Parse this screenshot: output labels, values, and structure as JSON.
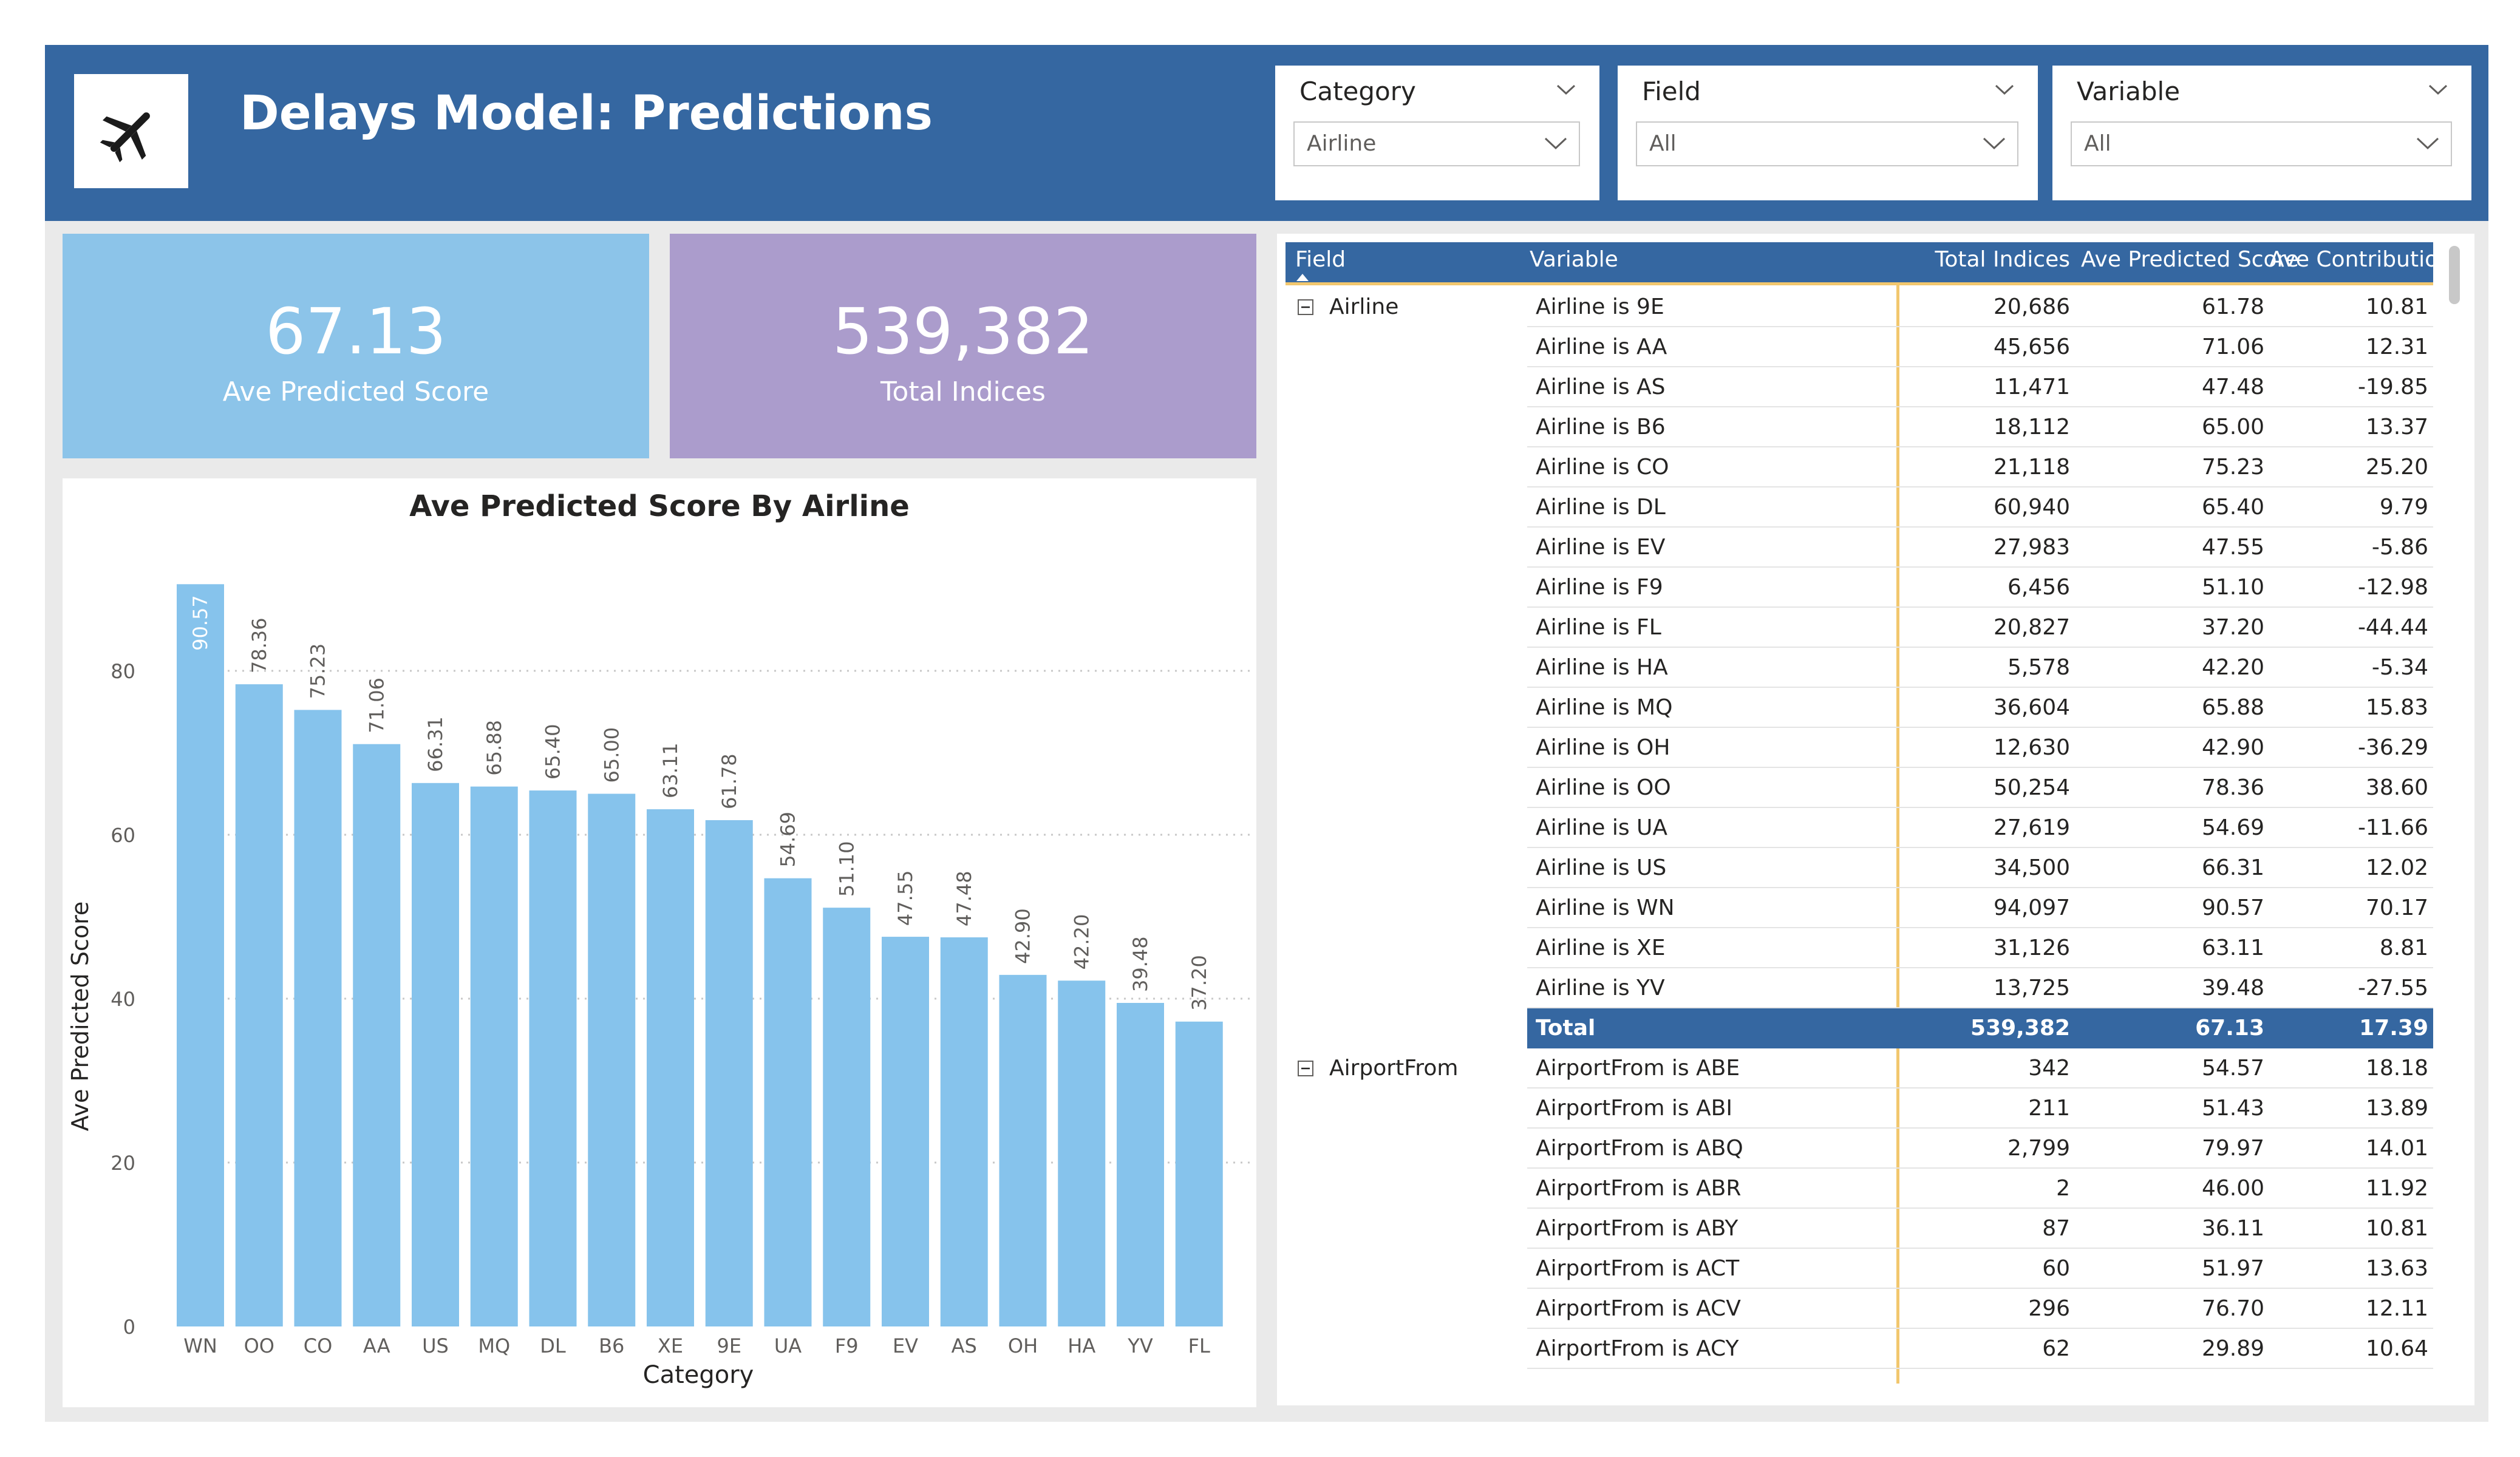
{
  "header": {
    "title": "Delays Model: Predictions",
    "logo_icon": "airplane-icon"
  },
  "filters": [
    {
      "label": "Category",
      "value": "Airline"
    },
    {
      "label": "Field",
      "value": "All"
    },
    {
      "label": "Variable",
      "value": "All"
    }
  ],
  "kpis": [
    {
      "value": "67.13",
      "label": "Ave Predicted Score",
      "color": "#8cc4e9"
    },
    {
      "value": "539,382",
      "label": "Total Indices",
      "color": "#ab9ccc"
    }
  ],
  "chart_data": {
    "type": "bar",
    "title": "Ave Predicted Score By Airline",
    "xlabel": "Category",
    "ylabel": "Ave Predicted Score",
    "categories": [
      "WN",
      "OO",
      "CO",
      "AA",
      "US",
      "MQ",
      "DL",
      "B6",
      "XE",
      "9E",
      "UA",
      "F9",
      "EV",
      "AS",
      "OH",
      "HA",
      "YV",
      "FL"
    ],
    "values": [
      90.57,
      78.36,
      75.23,
      71.06,
      66.31,
      65.88,
      65.4,
      65.0,
      63.11,
      61.78,
      54.69,
      51.1,
      47.55,
      47.48,
      42.9,
      42.2,
      39.48,
      37.2
    ],
    "data_labels": [
      "90.57",
      "78.36",
      "75.23",
      "71.06",
      "66.31",
      "65.88",
      "65.40",
      "65.00",
      "63.11",
      "61.78",
      "54.69",
      "51.10",
      "47.55",
      "47.48",
      "42.90",
      "42.20",
      "39.48",
      "37.20"
    ],
    "yticks": [
      "0",
      "20",
      "40",
      "60",
      "80"
    ],
    "ylim": [
      0,
      92
    ],
    "bar_color": "#86c3ec",
    "grid": true
  },
  "table": {
    "columns": [
      "Field",
      "Variable",
      "Total Indices",
      "Ave Predicted Score",
      "Ave Contribution"
    ],
    "accent_color": "#f2c76e",
    "groups": [
      {
        "field": "Airline",
        "rows": [
          [
            "Airline is 9E",
            "20,686",
            "61.78",
            "10.81"
          ],
          [
            "Airline is AA",
            "45,656",
            "71.06",
            "12.31"
          ],
          [
            "Airline is AS",
            "11,471",
            "47.48",
            "-19.85"
          ],
          [
            "Airline is B6",
            "18,112",
            "65.00",
            "13.37"
          ],
          [
            "Airline is CO",
            "21,118",
            "75.23",
            "25.20"
          ],
          [
            "Airline is DL",
            "60,940",
            "65.40",
            "9.79"
          ],
          [
            "Airline is EV",
            "27,983",
            "47.55",
            "-5.86"
          ],
          [
            "Airline is F9",
            "6,456",
            "51.10",
            "-12.98"
          ],
          [
            "Airline is FL",
            "20,827",
            "37.20",
            "-44.44"
          ],
          [
            "Airline is HA",
            "5,578",
            "42.20",
            "-5.34"
          ],
          [
            "Airline is MQ",
            "36,604",
            "65.88",
            "15.83"
          ],
          [
            "Airline is OH",
            "12,630",
            "42.90",
            "-36.29"
          ],
          [
            "Airline is OO",
            "50,254",
            "78.36",
            "38.60"
          ],
          [
            "Airline is UA",
            "27,619",
            "54.69",
            "-11.66"
          ],
          [
            "Airline is US",
            "34,500",
            "66.31",
            "12.02"
          ],
          [
            "Airline is WN",
            "94,097",
            "90.57",
            "70.17"
          ],
          [
            "Airline is XE",
            "31,126",
            "63.11",
            "8.81"
          ],
          [
            "Airline is YV",
            "13,725",
            "39.48",
            "-27.55"
          ]
        ],
        "total": [
          "Total",
          "539,382",
          "67.13",
          "17.39"
        ]
      },
      {
        "field": "AirportFrom",
        "rows": [
          [
            "AirportFrom is ABE",
            "342",
            "54.57",
            "18.18"
          ],
          [
            "AirportFrom is ABI",
            "211",
            "51.43",
            "13.89"
          ],
          [
            "AirportFrom is ABQ",
            "2,799",
            "79.97",
            "14.01"
          ],
          [
            "AirportFrom is ABR",
            "2",
            "46.00",
            "11.92"
          ],
          [
            "AirportFrom is ABY",
            "87",
            "36.11",
            "10.81"
          ],
          [
            "AirportFrom is ACT",
            "60",
            "51.97",
            "13.63"
          ],
          [
            "AirportFrom is ACV",
            "296",
            "76.70",
            "12.11"
          ],
          [
            "AirportFrom is ACY",
            "62",
            "29.89",
            "10.64"
          ]
        ]
      }
    ]
  }
}
